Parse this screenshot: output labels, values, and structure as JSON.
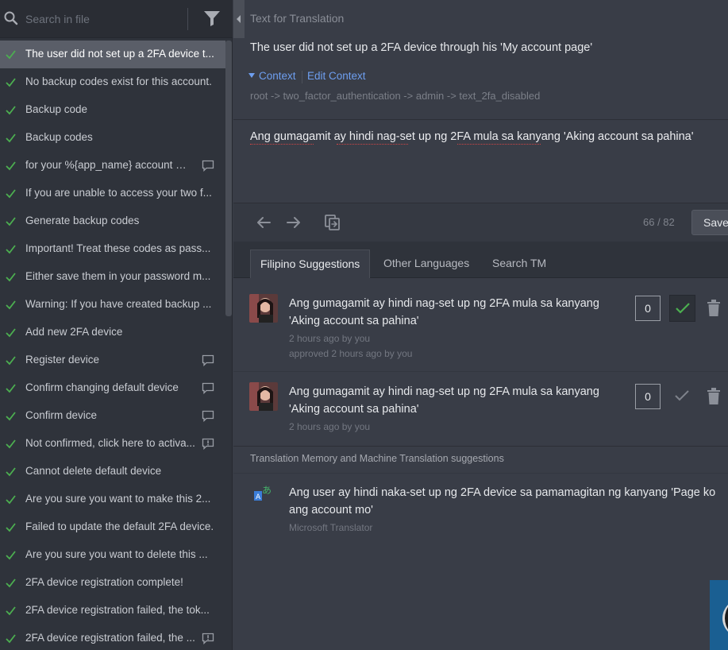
{
  "search": {
    "placeholder": "Search in file"
  },
  "strings": [
    {
      "label": "The user did not set up a 2FA device t...",
      "selected": true,
      "badge": ""
    },
    {
      "label": "No backup codes exist for this account.",
      "badge": ""
    },
    {
      "label": "Backup code",
      "badge": ""
    },
    {
      "label": "Backup codes",
      "badge": ""
    },
    {
      "label": "for your %{app_name} account %{...",
      "badge": "comment-icon"
    },
    {
      "label": "If you are unable to access your two f...",
      "badge": ""
    },
    {
      "label": "Generate backup codes",
      "badge": ""
    },
    {
      "label": "Important! Treat these codes as pass...",
      "badge": ""
    },
    {
      "label": "Either save them in your password m...",
      "badge": ""
    },
    {
      "label": "Warning: If you have created backup ...",
      "badge": ""
    },
    {
      "label": "Add new 2FA device",
      "badge": ""
    },
    {
      "label": "Register device",
      "badge": "comment-icon"
    },
    {
      "label": "Confirm changing default device",
      "badge": "comment-icon"
    },
    {
      "label": "Confirm device",
      "badge": "comment-icon"
    },
    {
      "label": "Not confirmed, click here to activa...",
      "badge": "issue-icon"
    },
    {
      "label": "Cannot delete default device",
      "badge": ""
    },
    {
      "label": "Are you sure you want to make this 2...",
      "badge": ""
    },
    {
      "label": "Failed to update the default 2FA device.",
      "badge": ""
    },
    {
      "label": "Are you sure you want to delete this ...",
      "badge": ""
    },
    {
      "label": "2FA device registration complete!",
      "badge": ""
    },
    {
      "label": "2FA device registration failed, the tok...",
      "badge": ""
    },
    {
      "label": "2FA device registration failed, the ...",
      "badge": "issue-icon"
    }
  ],
  "source": {
    "title": "Text for Translation",
    "text": "The user did not set up a 2FA device through his 'My account page'",
    "context_label": "Context",
    "edit_context_label": "Edit Context",
    "key_path": "root -> two_factor_authentication -> admin -> text_2fa_disabled"
  },
  "editor": {
    "value": "Ang gumagamit ay hindi nag-set up ng 2FA mula sa kanyang 'Aking account sa pahina'",
    "progress": "66 / 82",
    "save_label": "Save"
  },
  "tabs": [
    {
      "label": "Filipino Suggestions",
      "active": true
    },
    {
      "label": "Other Languages"
    },
    {
      "label": "Search TM"
    }
  ],
  "suggestions": [
    {
      "text": "Ang gumagamit ay hindi nag-set up ng 2FA mula sa kanyang 'Aking account sa pahina'",
      "meta1": "2 hours ago by you",
      "meta2": "approved 2 hours ago by you",
      "votes": "0",
      "approved": true
    },
    {
      "text": "Ang gumagamit ay hindi nag-set up ng 2FA mula sa kanyang 'Aking account sa pahina'",
      "meta1": "2 hours ago by you",
      "votes": "0",
      "approved": false
    }
  ],
  "tm": {
    "header": "Translation Memory and Machine Translation suggestions",
    "text": "Ang user ay hindi naka-set up ng 2FA device sa pamamagitan ng kanyang 'Page ko ang account mo'",
    "source": "Microsoft Translator"
  },
  "colors": {
    "accent": "#6e9ff0",
    "check": "#4caf50",
    "sidebar": "#2f333b",
    "main": "#393d47",
    "selected": "#5a5e68"
  }
}
